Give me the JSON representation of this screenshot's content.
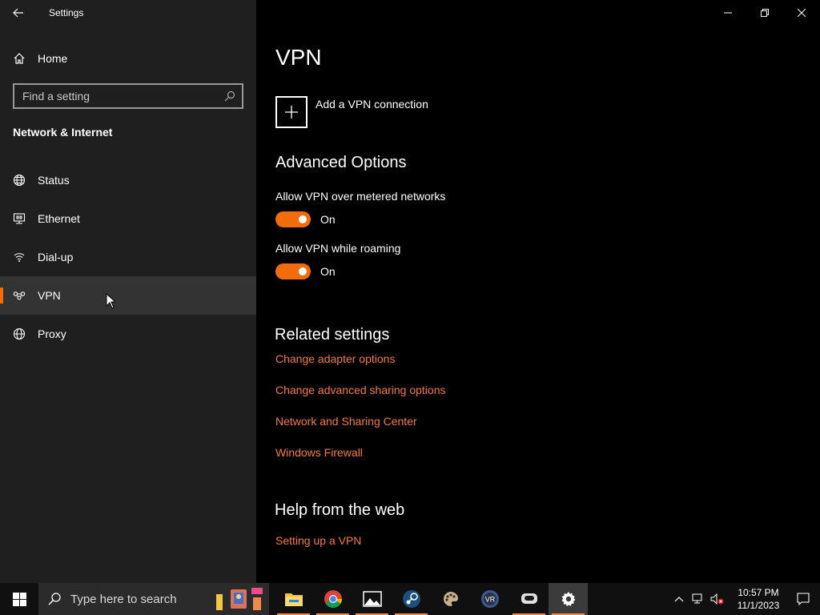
{
  "window": {
    "title": "Settings"
  },
  "sidebar": {
    "home_label": "Home",
    "search_placeholder": "Find a setting",
    "section_title": "Network & Internet",
    "items": [
      {
        "label": "Status",
        "icon": "globe-status-icon"
      },
      {
        "label": "Ethernet",
        "icon": "ethernet-icon"
      },
      {
        "label": "Dial-up",
        "icon": "dialup-icon"
      },
      {
        "label": "VPN",
        "icon": "vpn-icon",
        "selected": true
      },
      {
        "label": "Proxy",
        "icon": "globe-icon"
      }
    ]
  },
  "main": {
    "title": "VPN",
    "add_vpn_label": "Add a VPN connection",
    "advanced_title": "Advanced Options",
    "options": [
      {
        "label": "Allow VPN over metered networks",
        "state": "On"
      },
      {
        "label": "Allow VPN while roaming",
        "state": "On"
      }
    ],
    "related_title": "Related settings",
    "related_links": [
      "Change adapter options",
      "Change advanced sharing options",
      "Network and Sharing Center",
      "Windows Firewall"
    ],
    "help_title": "Help from the web",
    "help_links": [
      "Setting up a VPN"
    ]
  },
  "taskbar": {
    "search_placeholder": "Type here to search",
    "time": "10:57 PM",
    "date": "11/1/2023"
  },
  "colors": {
    "accent": "#f26c0c",
    "link": "#f5793a",
    "sidebar_bg": "#1f1f1f",
    "main_bg": "#000000"
  }
}
